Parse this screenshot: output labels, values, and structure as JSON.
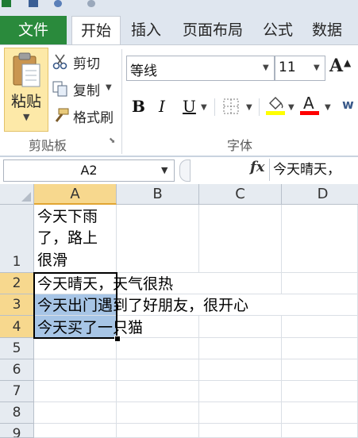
{
  "ribbon": {
    "file_tab": "文件",
    "tabs": [
      "开始",
      "插入",
      "页面布局",
      "公式",
      "数据"
    ],
    "clipboard": {
      "paste_label": "粘贴",
      "cut_label": "剪切",
      "copy_label": "复制",
      "format_painter_label": "格式刷",
      "group_label": "剪贴板"
    },
    "font": {
      "font_name": "等线",
      "font_size": "11",
      "bold": "B",
      "italic": "I",
      "underline": "U",
      "group_label": "字体",
      "font_color_glyph": "A",
      "grow_glyph": "A"
    },
    "colors": {
      "accent_green": "#2a8a3c",
      "highlight_yellow": "#ffff00",
      "font_red": "#ff0000"
    }
  },
  "formula_bar": {
    "name_box": "A2",
    "fx": "fx",
    "formula_text": "今天晴天，"
  },
  "grid": {
    "columns": [
      "A",
      "B",
      "C",
      "D"
    ],
    "rows": [
      "1",
      "2",
      "3",
      "4",
      "5",
      "6",
      "7",
      "8",
      "9"
    ],
    "cells": {
      "A1_line1": "今天下雨",
      "A1_line2": "了，路上",
      "A1_line3": "很滑",
      "A2": "今天晴天，天气很热",
      "A3": "今天出门遇到了好朋友，很开心",
      "A4": "今天买了一只猫"
    },
    "selected_cell": "A2",
    "selected_range": "A2:A4"
  }
}
